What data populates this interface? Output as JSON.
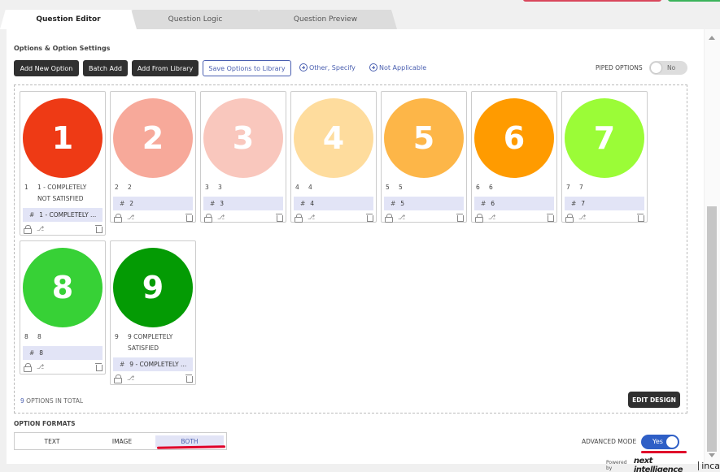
{
  "tabs": [
    {
      "label": "Question Editor",
      "active": true
    },
    {
      "label": "Question Logic",
      "active": false
    },
    {
      "label": "Question Preview",
      "active": false
    }
  ],
  "section_title": "Options & Option Settings",
  "toolbar": {
    "add_new": "Add New Option",
    "batch_add": "Batch Add",
    "add_from_library": "Add From Library",
    "save_to_library": "Save Options to Library",
    "other_specify": "Other, Specify",
    "not_applicable": "Not Applicable"
  },
  "piped_options": {
    "label": "PIPED OPTIONS",
    "value": "No"
  },
  "options": [
    {
      "number": "1",
      "code": "1",
      "label": "1 - COMPLETELY NOT SATISFIED",
      "tag": "1 - COMPLETELY ...",
      "color": "#ee3a15"
    },
    {
      "number": "2",
      "code": "2",
      "label": "2",
      "tag": "2",
      "color": "#f7a99a"
    },
    {
      "number": "3",
      "code": "3",
      "label": "3",
      "tag": "3",
      "color": "#f9c7bd"
    },
    {
      "number": "4",
      "code": "4",
      "label": "4",
      "tag": "4",
      "color": "#fedc9d"
    },
    {
      "number": "5",
      "code": "5",
      "label": "5",
      "tag": "5",
      "color": "#fdb648"
    },
    {
      "number": "6",
      "code": "6",
      "label": "6",
      "tag": "6",
      "color": "#ff9b00"
    },
    {
      "number": "7",
      "code": "7",
      "label": "7",
      "tag": "7",
      "color": "#9bfc37"
    },
    {
      "number": "8",
      "code": "8",
      "label": "8",
      "tag": "8",
      "color": "#37d136"
    },
    {
      "number": "9",
      "code": "9",
      "label": "9 COMPLETELY SATISFIED",
      "tag": "9 - COMPLETELY ...",
      "color": "#049b04"
    }
  ],
  "total": {
    "count": "9",
    "suffix": "OPTIONS IN TOTAL"
  },
  "edit_design": "EDIT DESIGN",
  "option_formats": {
    "label": "OPTION FORMATS",
    "items": [
      "TEXT",
      "IMAGE",
      "BOTH"
    ],
    "selected": "BOTH"
  },
  "advanced_mode": {
    "label": "ADVANCED MODE",
    "value": "Yes"
  },
  "footer": {
    "powered_by": "Powered by",
    "brand": "next intelligence",
    "brand2": "inca"
  }
}
